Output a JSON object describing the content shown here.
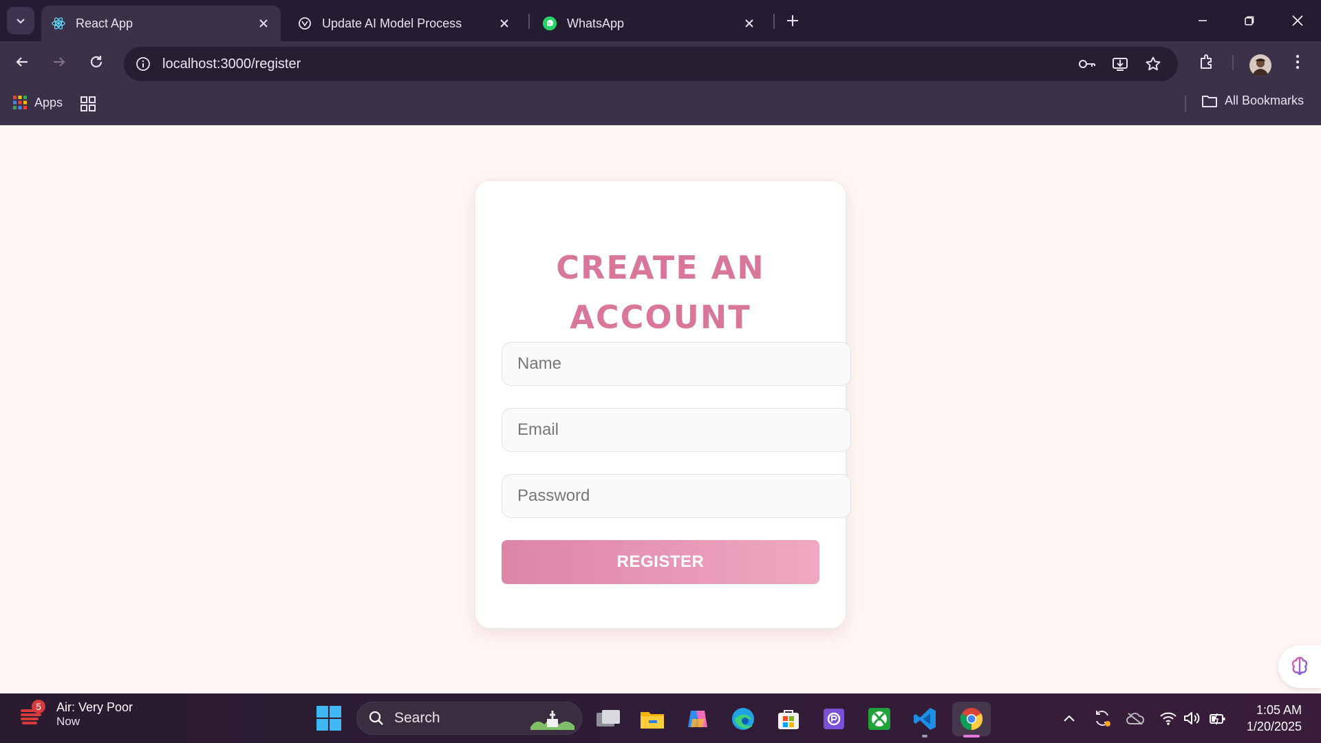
{
  "browser": {
    "tabs": [
      {
        "title": "React App",
        "icon": "react-icon",
        "active": true
      },
      {
        "title": "Update AI Model Process",
        "icon": "openai-icon",
        "active": false
      },
      {
        "title": "WhatsApp",
        "icon": "whatsapp-icon",
        "active": false
      }
    ],
    "url": "localhost:3000/register",
    "bookmarks": {
      "apps_label": "Apps",
      "all_bookmarks_label": "All Bookmarks"
    }
  },
  "form": {
    "title_line1": "CREATE AN",
    "title_line2": "ACCOUNT",
    "name_placeholder": "Name",
    "email_placeholder": "Email",
    "password_placeholder": "Password",
    "submit_label": "REGISTER",
    "accent_color": "#d9779b"
  },
  "taskbar": {
    "weather_badge": "5",
    "weather_line1": "Air: Very Poor",
    "weather_line2": "Now",
    "search_label": "Search",
    "time": "1:05 AM",
    "date": "1/20/2025"
  }
}
